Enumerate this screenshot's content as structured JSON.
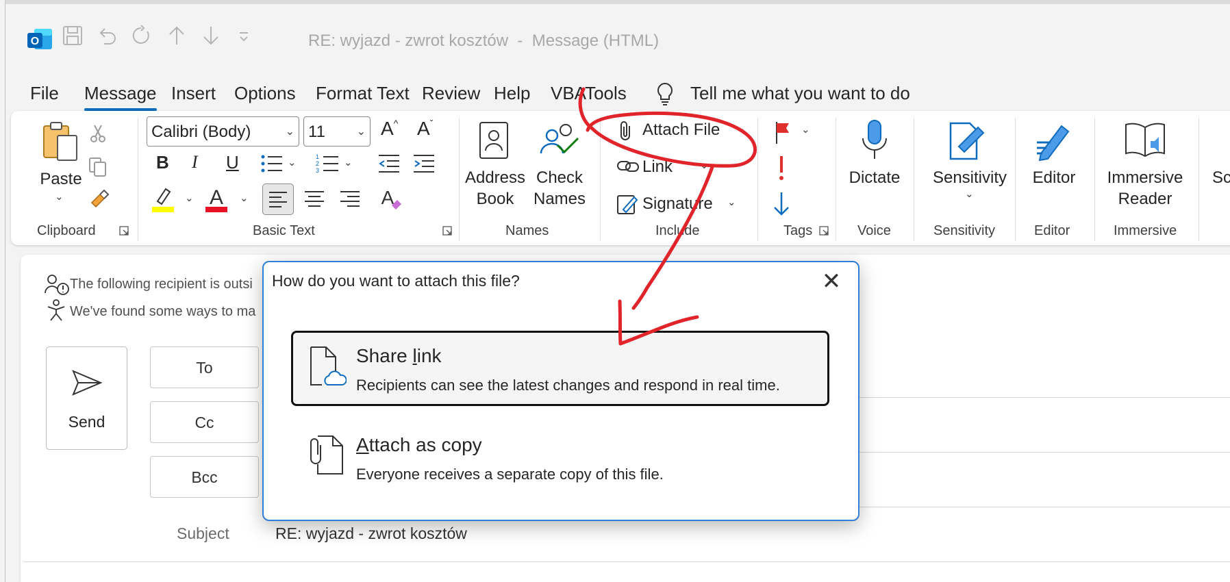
{
  "window": {
    "title": "RE: wyjazd - zwrot kosztów  -  Message (HTML)"
  },
  "menu": [
    "File",
    "Message",
    "Insert",
    "Options",
    "Format Text",
    "Review",
    "Help",
    "VBATools"
  ],
  "tell_me": "Tell me what you want to do",
  "ribbon": {
    "clipboard": {
      "paste": "Paste",
      "label": "Clipboard"
    },
    "basic_text": {
      "font": "Calibri (Body)",
      "size": "11",
      "label": "Basic Text",
      "bold": "B",
      "italic": "I",
      "underline": "U"
    },
    "names": {
      "address_book": [
        "Address",
        "Book"
      ],
      "check_names": [
        "Check",
        "Names"
      ],
      "label": "Names"
    },
    "include": {
      "attach_file": "Attach File",
      "link": "Link",
      "signature": "Signature",
      "label": "Include"
    },
    "tags": {
      "label": "Tags"
    },
    "voice": {
      "dictate": "Dictate",
      "label": "Voice"
    },
    "sensitivity": {
      "button": "Sensitivity",
      "label": "Sensitivity"
    },
    "editor": {
      "button": "Editor",
      "label": "Editor"
    },
    "immersive": {
      "button": [
        "Immersive",
        "Reader"
      ],
      "label": "Immersive"
    },
    "cut_off": "Sc"
  },
  "compose": {
    "info1": "The following recipient is outsi",
    "info2": "We've found some ways to ma",
    "send": "Send",
    "to": "To",
    "cc": "Cc",
    "bcc": "Bcc",
    "subject_label": "Subject",
    "subject_value": "RE: wyjazd - zwrot kosztów"
  },
  "dialog": {
    "title": "How do you want to attach this file?",
    "options": [
      {
        "title_pre": "Share ",
        "title_key": "l",
        "title_post": "ink",
        "desc": "Recipients can see the latest changes and respond in real time."
      },
      {
        "title_pre": "",
        "title_key": "A",
        "title_post": "ttach as copy",
        "desc": "Everyone receives a separate copy of this file."
      }
    ]
  },
  "colors": {
    "accent": "#0f6cbd",
    "highlight": "#ffff00",
    "font_color": "#e81123",
    "annotation": "#e0242a"
  }
}
